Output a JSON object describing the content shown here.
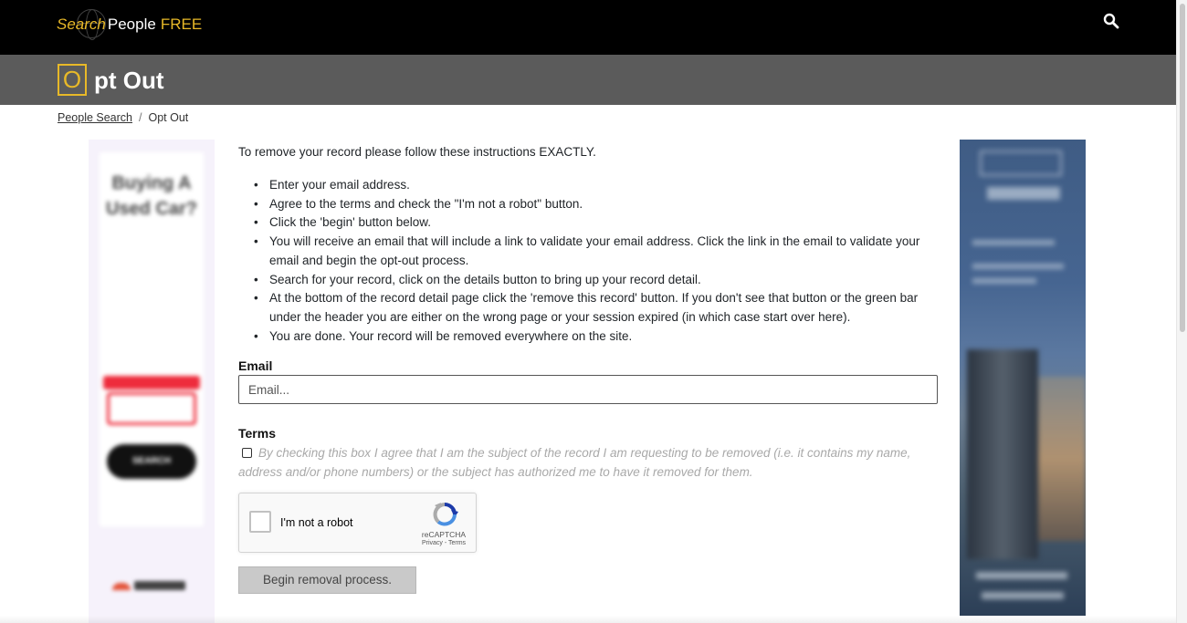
{
  "header": {
    "logo_search": "Search",
    "logo_people": "People",
    "logo_free": "FREE",
    "search_icon": "magnifier-icon"
  },
  "title": {
    "boxed_letter": "O",
    "rest": "pt Out"
  },
  "breadcrumb": {
    "home": "People Search",
    "separator": "/",
    "current": "Opt Out"
  },
  "ads": {
    "left_headline": "Buying A Used Car?",
    "left_button": "SEARCH"
  },
  "content": {
    "intro": "To remove your record please follow these instructions EXACTLY.",
    "steps": [
      "Enter your email address.",
      "Agree to the terms and check the \"I'm not a robot\" button.",
      "Click the 'begin' button below.",
      "You will receive an email that will include a link to validate your email address. Click the link in the email to validate your email and begin the opt-out process.",
      "Search for your record, click on the details button to bring up your record detail.",
      "At the bottom of the record detail page click the 'remove this record' button. If you don't see that button or the green bar under the header you are either on the wrong page or your session expired (in which case start over here).",
      "You are done. Your record will be removed everywhere on the site."
    ]
  },
  "form": {
    "email_label": "Email",
    "email_placeholder": "Email...",
    "email_value": "",
    "terms_label": "Terms",
    "terms_text": "By checking this box I agree that I am the subject of the record I am requesting to be removed (i.e. it contains my name, address and/or phone numbers) or the subject has authorized me to have it removed for them.",
    "terms_checked": false,
    "recaptcha_label": "I'm not a robot",
    "recaptcha_brand": "reCAPTCHA",
    "recaptcha_links": "Privacy - Terms",
    "submit_label": "Begin removal process."
  },
  "colors": {
    "accent": "#e8b928",
    "header_bg": "#000000",
    "titlebar_bg": "#5b5b5b"
  }
}
